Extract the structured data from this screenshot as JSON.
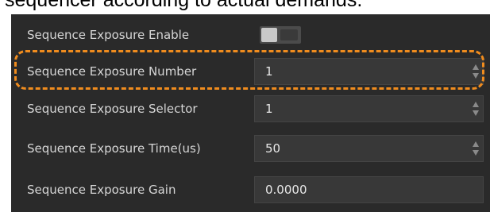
{
  "caption": {
    "text": "sequencer according to actual demands."
  },
  "panel": {
    "rows": [
      {
        "label": "Sequence Exposure Enable",
        "control": "toggle",
        "enabled": false
      },
      {
        "label": "Sequence Exposure Number",
        "control": "spinbox",
        "value": "1"
      },
      {
        "label": "Sequence Exposure Selector",
        "control": "spinbox",
        "value": "1"
      },
      {
        "label": "Sequence Exposure Time(us)",
        "control": "spinbox",
        "value": "50"
      },
      {
        "label": "Sequence Exposure Gain",
        "control": "text",
        "value": "0.0000"
      }
    ]
  },
  "icons": {
    "spin_up": "chevron-up-icon",
    "spin_down": "chevron-down-icon"
  },
  "colors": {
    "panel_bg": "#2a2a2a",
    "field_bg": "#383838",
    "label_text": "#d6d6d6",
    "highlight": "#f08c1e"
  }
}
